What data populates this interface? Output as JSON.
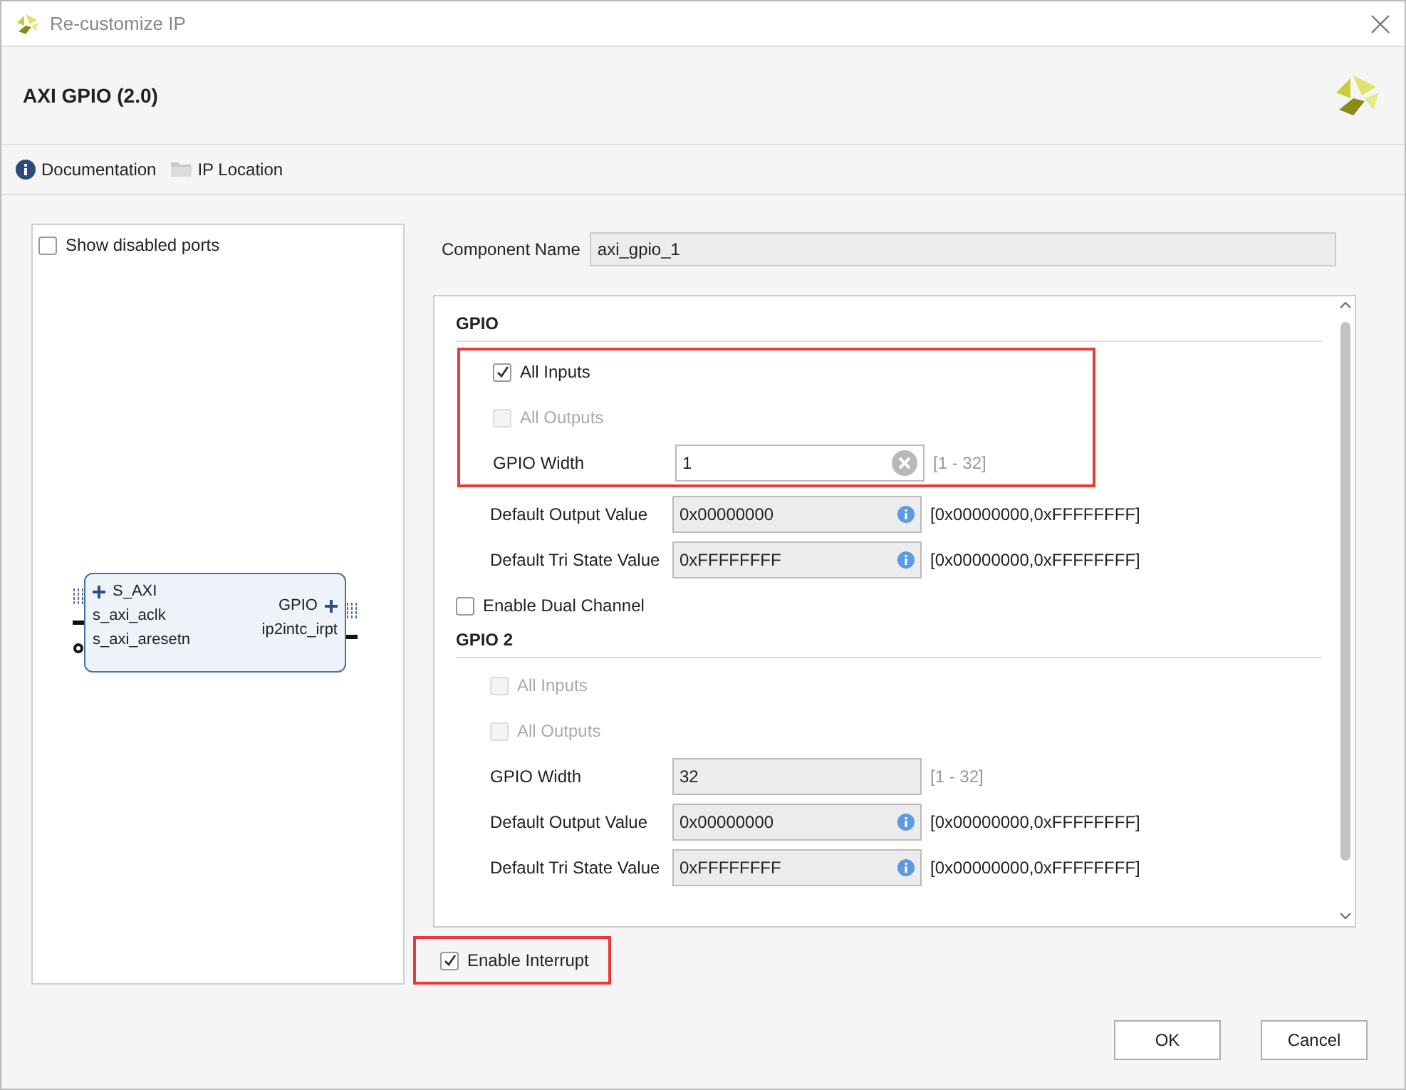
{
  "window": {
    "title": "Re-customize IP"
  },
  "header": {
    "title": "AXI GPIO (2.0)"
  },
  "links": [
    {
      "kind": "info",
      "label": "Documentation"
    },
    {
      "kind": "folder",
      "label": "IP Location"
    }
  ],
  "symbol_panel": {
    "show_disabled_ports": {
      "label": "Show disabled ports",
      "checked": false
    },
    "left_ports": [
      {
        "kind": "bus",
        "label": "S_AXI"
      },
      {
        "kind": "clock",
        "label": "s_axi_aclk"
      },
      {
        "kind": "reset",
        "label": "s_axi_aresetn"
      }
    ],
    "right_ports": [
      {
        "kind": "bus",
        "label": "GPIO"
      },
      {
        "kind": "wire",
        "label": "ip2intc_irpt"
      }
    ]
  },
  "component_name": {
    "label": "Component Name",
    "value": "axi_gpio_1"
  },
  "panel_items": [
    {
      "kind": "section",
      "title": "GPIO",
      "groups": [
        {
          "highlighted": true,
          "rows": [
            {
              "kind": "checkbox",
              "label": "All Inputs",
              "checked": true,
              "disabled": false
            },
            {
              "kind": "checkbox",
              "label": "All Outputs",
              "checked": false,
              "disabled": true
            },
            {
              "kind": "field",
              "label": "GPIO Width",
              "value": "1",
              "disabled": false,
              "clearable": true,
              "info": false,
              "range": "[1 - 32]",
              "range_dim": true
            }
          ]
        },
        {
          "highlighted": false,
          "rows": [
            {
              "kind": "field",
              "label": "Default Output Value",
              "value": "0x00000000",
              "disabled": true,
              "clearable": false,
              "info": true,
              "range": "[0x00000000,0xFFFFFFFF]",
              "range_dim": false
            },
            {
              "kind": "field",
              "label": "Default Tri State Value",
              "value": "0xFFFFFFFF",
              "disabled": true,
              "clearable": false,
              "info": true,
              "range": "[0x00000000,0xFFFFFFFF]",
              "range_dim": false
            }
          ]
        }
      ]
    },
    {
      "kind": "checkbox",
      "label": "Enable Dual Channel",
      "checked": false,
      "disabled": false
    },
    {
      "kind": "section",
      "title": "GPIO 2",
      "groups": [
        {
          "highlighted": false,
          "rows": [
            {
              "kind": "checkbox",
              "label": "All Inputs",
              "checked": false,
              "disabled": true
            },
            {
              "kind": "checkbox",
              "label": "All Outputs",
              "checked": false,
              "disabled": true
            },
            {
              "kind": "field",
              "label": "GPIO Width",
              "value": "32",
              "disabled": true,
              "clearable": false,
              "info": false,
              "range": "[1 - 32]",
              "range_dim": true
            },
            {
              "kind": "field",
              "label": "Default Output Value",
              "value": "0x00000000",
              "disabled": true,
              "clearable": false,
              "info": true,
              "range": "[0x00000000,0xFFFFFFFF]",
              "range_dim": false
            },
            {
              "kind": "field",
              "label": "Default Tri State Value",
              "value": "0xFFFFFFFF",
              "disabled": true,
              "clearable": false,
              "info": true,
              "range": "[0x00000000,0xFFFFFFFF]",
              "range_dim": false
            }
          ]
        }
      ]
    }
  ],
  "enable_interrupt": {
    "label": "Enable Interrupt",
    "checked": true,
    "highlighted": true
  },
  "buttons": [
    {
      "label": "OK"
    },
    {
      "label": "Cancel"
    }
  ]
}
